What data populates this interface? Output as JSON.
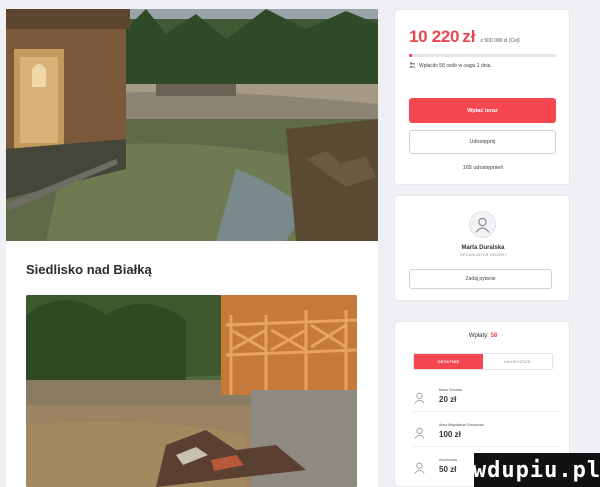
{
  "campaign": {
    "title": "Siedlisko nad Białką"
  },
  "donate": {
    "raised_amount": "10 220",
    "currency": "zł",
    "goal_text": "z 500 000 zł (Cel)",
    "progress_fraction": 0.02,
    "supporters_text": "Wpłaciło 58 osób w ciągu 1 dnia.",
    "donate_button": "Wpłać teraz",
    "share_button": "Udostępnij",
    "shares_text": "165 udostępnień"
  },
  "organizer": {
    "name": "Marta Duralska",
    "role": "ORGANIZATOR ZBIÓRKI",
    "ask_button": "Zadaj pytanie"
  },
  "payments": {
    "label": "Wpłaty:",
    "count": "58",
    "tabs": [
      {
        "label": "OSTATNIE",
        "active": true
      },
      {
        "label": "NAJWYŻSZE",
        "active": false
      }
    ],
    "items": [
      {
        "name": "Basia Chudala",
        "amount": "20 zł"
      },
      {
        "name": "Anna Magdalena Duszyńska",
        "amount": "100 zł"
      },
      {
        "name": "Anonimowy",
        "amount": "50 zł"
      }
    ]
  },
  "watermark": {
    "text": "wdupiu.pl"
  },
  "colors": {
    "accent": "#e8474f",
    "button": "#f4474f"
  }
}
